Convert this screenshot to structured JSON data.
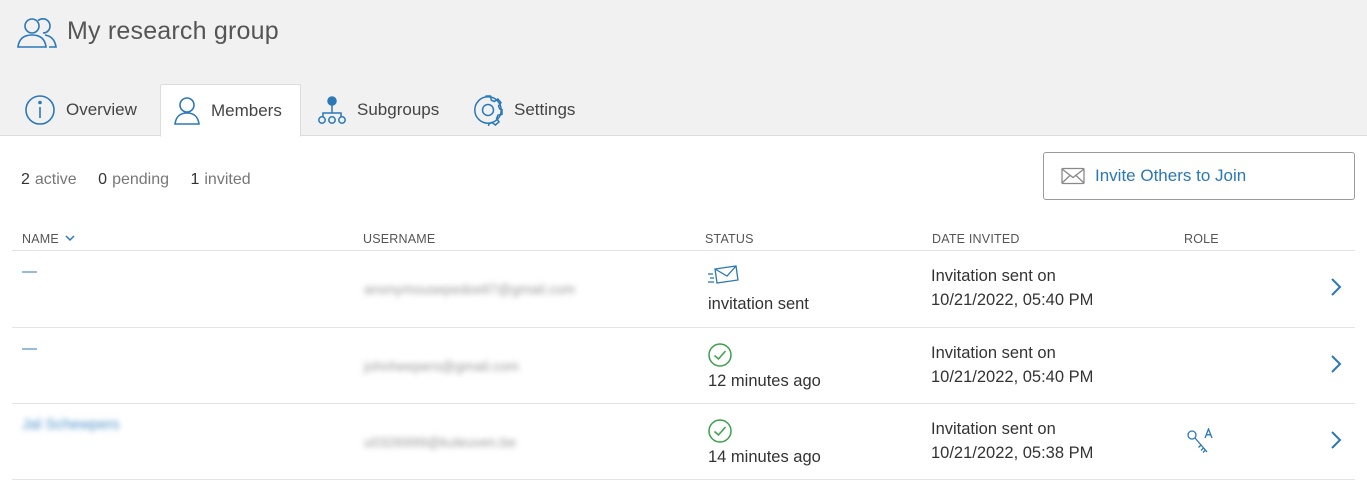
{
  "header": {
    "title": "My research group",
    "icon": "group-icon"
  },
  "tabs": [
    {
      "label": "Overview",
      "icon": "info-icon",
      "active": false
    },
    {
      "label": "Members",
      "icon": "person-icon",
      "active": true
    },
    {
      "label": "Subgroups",
      "icon": "subgroups-icon",
      "active": false
    },
    {
      "label": "Settings",
      "icon": "gear-icon",
      "active": false
    }
  ],
  "summary": {
    "active_count": "2",
    "active_label": "active",
    "pending_count": "0",
    "pending_label": "pending",
    "invited_count": "1",
    "invited_label": "invited"
  },
  "invite_button": {
    "label": "Invite Others to Join",
    "icon": "envelope-icon"
  },
  "columns": {
    "name": "NAME",
    "username": "USERNAME",
    "status": "STATUS",
    "date_invited": "DATE INVITED",
    "role": "ROLE"
  },
  "rows": [
    {
      "name": "—",
      "username": "anonymousepedoell7@gmail.com",
      "status_icon": "envelope-sent-icon",
      "status": "invitation sent",
      "date_line1": "Invitation sent on",
      "date_line2": "10/21/2022, 05:40 PM",
      "role_icon": ""
    },
    {
      "name": "—",
      "username": "johnheepers@gmail.com",
      "status_icon": "check-circle-icon",
      "status": "12 minutes ago",
      "date_line1": "Invitation sent on",
      "date_line2": "10/21/2022, 05:40 PM",
      "role_icon": ""
    },
    {
      "name": "Jal Schewpers",
      "username": "u0326999@kuleuven.be",
      "status_icon": "check-circle-icon",
      "status": "14 minutes ago",
      "date_line1": "Invitation sent on",
      "date_line2": "10/21/2022, 05:38 PM",
      "role_icon": "admin-key-icon"
    }
  ],
  "colors": {
    "accent": "#2a78b8",
    "success": "#3aa04a",
    "header_bg": "#f1f1f1"
  }
}
